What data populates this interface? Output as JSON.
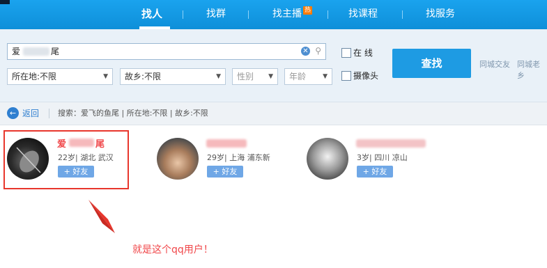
{
  "nav": {
    "tabs": [
      {
        "label": "找人"
      },
      {
        "label": "找群"
      },
      {
        "label": "找主播",
        "badge": "热"
      },
      {
        "label": "找课程"
      },
      {
        "label": "找服务"
      }
    ]
  },
  "search": {
    "name_value_prefix": "爱",
    "name_value_suffix": "尾",
    "location": "所在地:不限",
    "hometown": "故乡:不限",
    "gender": "性别",
    "age": "年龄",
    "online_label": "在 线",
    "camera_label": "摄像头",
    "find_button": "查找",
    "side_links": [
      "同城交友",
      "同城老乡"
    ]
  },
  "breadcrumb": {
    "back": "返回",
    "text": "搜索：爱飞的鱼尾 | 所在地:不限 | 故乡:不限"
  },
  "results": [
    {
      "name_prefix": "爱",
      "name_suffix": "尾",
      "info": "22岁| 湖北 武汉",
      "add": "+ 好友"
    },
    {
      "name_prefix": "",
      "name_suffix": "",
      "info": "29岁| 上海 浦东新",
      "add": "+ 好友"
    },
    {
      "name_prefix": "",
      "name_suffix": "",
      "info": "3岁| 四川 凉山",
      "add": "+ 好友"
    }
  ],
  "annotation": "就是这个qq用户！",
  "colors": {
    "brand": "#1aa3ee",
    "highlight": "#e8362c",
    "note": "#f0474a"
  }
}
